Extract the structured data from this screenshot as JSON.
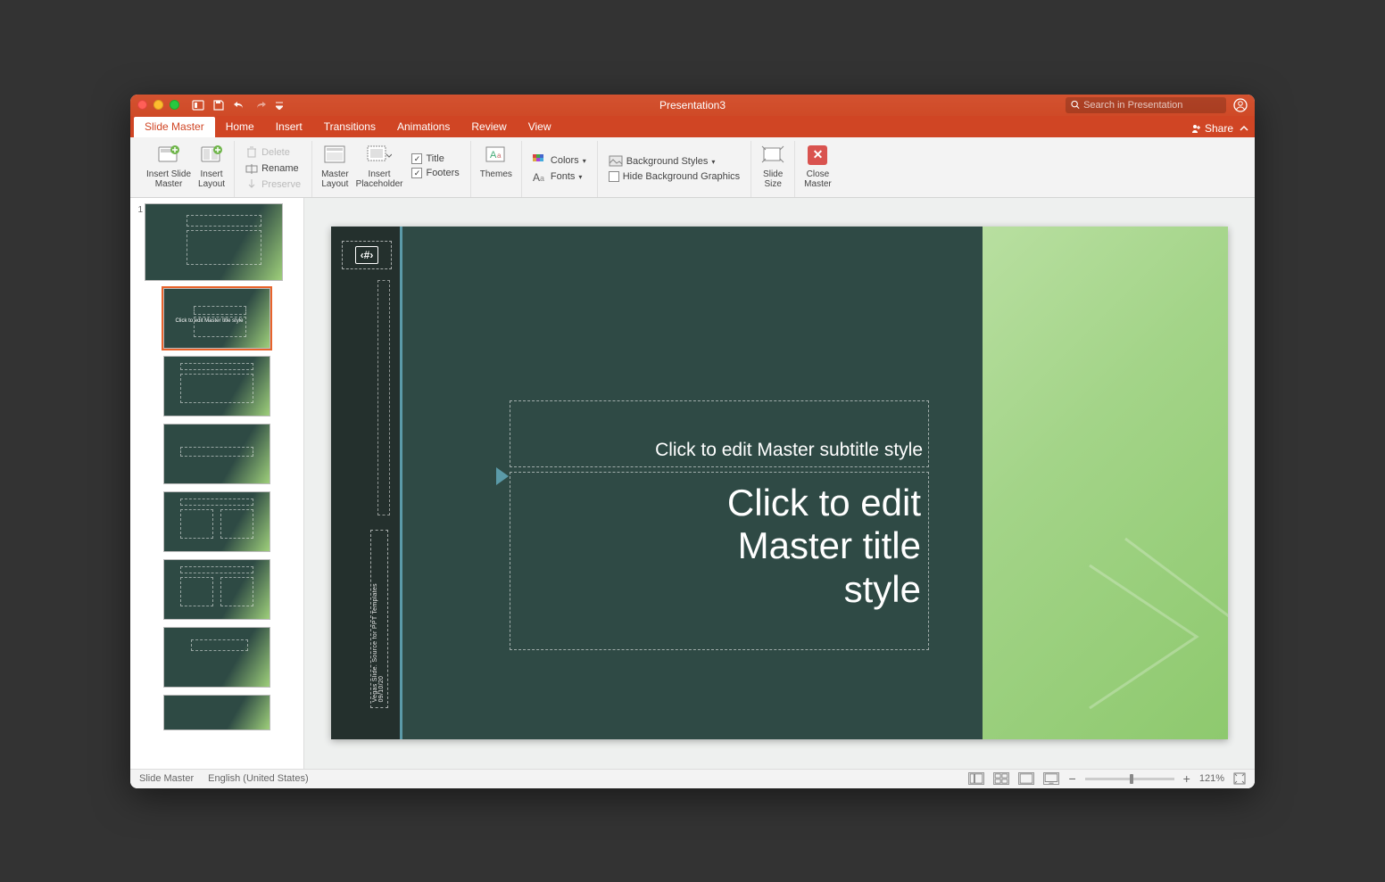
{
  "title": "Presentation3",
  "search_placeholder": "Search in Presentation",
  "tabs": {
    "slide_master": "Slide Master",
    "home": "Home",
    "insert": "Insert",
    "transitions": "Transitions",
    "animations": "Animations",
    "review": "Review",
    "view": "View"
  },
  "share_label": "Share",
  "ribbon": {
    "insert_slide_master": "Insert Slide\nMaster",
    "insert_layout": "Insert\nLayout",
    "delete": "Delete",
    "rename": "Rename",
    "preserve": "Preserve",
    "master_layout": "Master\nLayout",
    "insert_placeholder": "Insert\nPlaceholder",
    "title_cb": "Title",
    "footers_cb": "Footers",
    "themes": "Themes",
    "colors": "Colors",
    "fonts": "Fonts",
    "background_styles": "Background Styles",
    "hide_background": "Hide Background Graphics",
    "slide_size": "Slide\nSize",
    "close_master": "Close\nMaster"
  },
  "slide": {
    "subtitle": "Click to edit Master subtitle style",
    "title": "Click to edit\nMaster title\nstyle",
    "sidebar_text": "Vegas Slide. Source for PPT Templates\n09/10/20",
    "hash": "‹#›"
  },
  "thumbnails": {
    "master_num": "1",
    "layout_title": "Click to edit\nMaster title\nstyle"
  },
  "status": {
    "view": "Slide Master",
    "lang": "English (United States)",
    "zoom": "121%"
  }
}
